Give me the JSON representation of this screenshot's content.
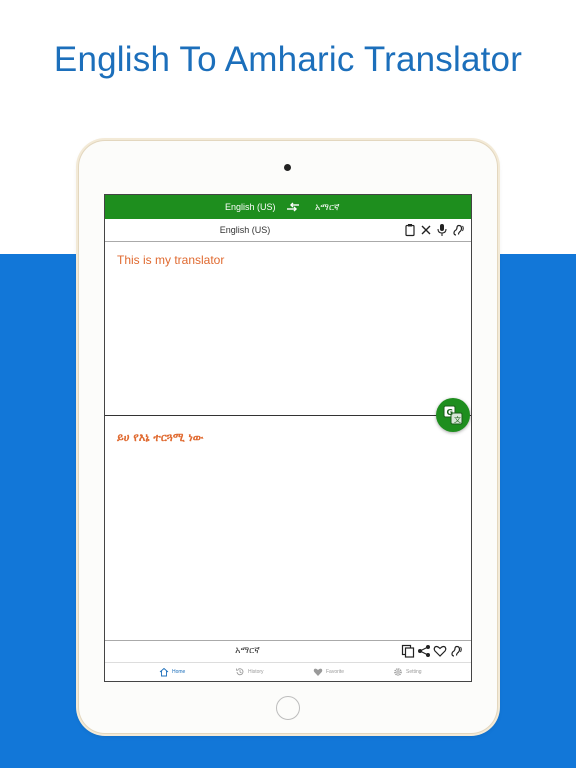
{
  "headline": "English To Amharic Translator",
  "header": {
    "source_lang": "English (US)",
    "target_lang": "አማርኛ"
  },
  "source_panel": {
    "lang_label": "English (US)",
    "text": "This is my translator"
  },
  "target_panel": {
    "text": "ይሀ የእኔ ተርጓሚ ነው",
    "lang_label": "አማርኛ"
  },
  "nav": {
    "items": [
      {
        "label": "Home",
        "icon": "home-icon"
      },
      {
        "label": "History",
        "icon": "history-icon"
      },
      {
        "label": "Favorite",
        "icon": "heart-icon"
      },
      {
        "label": "Setting",
        "icon": "gear-icon"
      }
    ]
  },
  "colors": {
    "header_green": "#1e8e1e",
    "accent_orange": "#e06a30",
    "brand_blue": "#1277d8",
    "headline_blue": "#1c6fbb"
  }
}
